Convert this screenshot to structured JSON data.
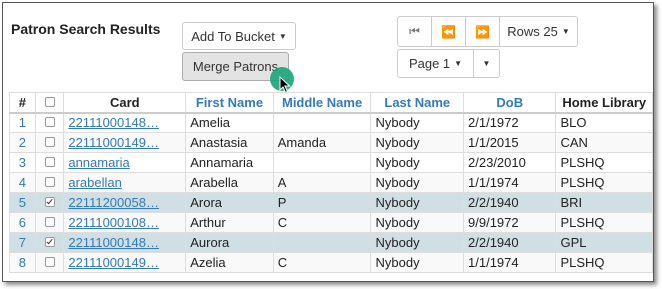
{
  "title": "Patron Search Results",
  "toolbar": {
    "add_to_bucket_label": "Add To Bucket",
    "merge_patrons_label": "Merge Patrons"
  },
  "pager": {
    "rows_label": "Rows 25",
    "page_label": "Page 1"
  },
  "table": {
    "headers": [
      "#",
      "",
      "Card",
      "First Name",
      "Middle Name",
      "Last Name",
      "DoB",
      "Home Library"
    ],
    "rows": [
      {
        "num": "1",
        "checked": false,
        "card": "22111000148…",
        "first": "Amelia",
        "middle": "",
        "last": "Nybody",
        "dob": "2/1/1972",
        "lib": "BLO"
      },
      {
        "num": "2",
        "checked": false,
        "card": "22111000149…",
        "first": "Anastasia",
        "middle": "Amanda",
        "last": "Nybody",
        "dob": "1/1/2015",
        "lib": "CAN"
      },
      {
        "num": "3",
        "checked": false,
        "card": "annamaria",
        "first": "Annamaria",
        "middle": "",
        "last": "Nybody",
        "dob": "2/23/2010",
        "lib": "PLSHQ"
      },
      {
        "num": "4",
        "checked": false,
        "card": "arabellan",
        "first": "Arabella",
        "middle": "A",
        "last": "Nybody",
        "dob": "1/1/1974",
        "lib": "PLSHQ"
      },
      {
        "num": "5",
        "checked": true,
        "card": "22111200058…",
        "first": "Arora",
        "middle": "P",
        "last": "Nybody",
        "dob": "2/2/1940",
        "lib": "BRI"
      },
      {
        "num": "6",
        "checked": false,
        "card": "22111000108…",
        "first": "Arthur",
        "middle": "C",
        "last": "Nybody",
        "dob": "9/9/1972",
        "lib": "PLSHQ"
      },
      {
        "num": "7",
        "checked": true,
        "card": "22111000148…",
        "first": "Aurora",
        "middle": "",
        "last": "Nybody",
        "dob": "2/2/1940",
        "lib": "GPL"
      },
      {
        "num": "8",
        "checked": false,
        "card": "22111000149…",
        "first": "Azelia",
        "middle": "C",
        "last": "Nybody",
        "dob": "1/1/1974",
        "lib": "PLSHQ"
      }
    ]
  },
  "icons": {
    "first_page": "double-bar-left-icon",
    "prev_page": "double-chevron-left-icon",
    "next_page": "double-chevron-right-icon",
    "caret": "caret-down-icon",
    "cursor": "mouse-pointer-icon"
  },
  "colors": {
    "link": "#337ab7",
    "selected_row": "#cfdfe3",
    "cursor_highlight": "#1aa37a"
  }
}
